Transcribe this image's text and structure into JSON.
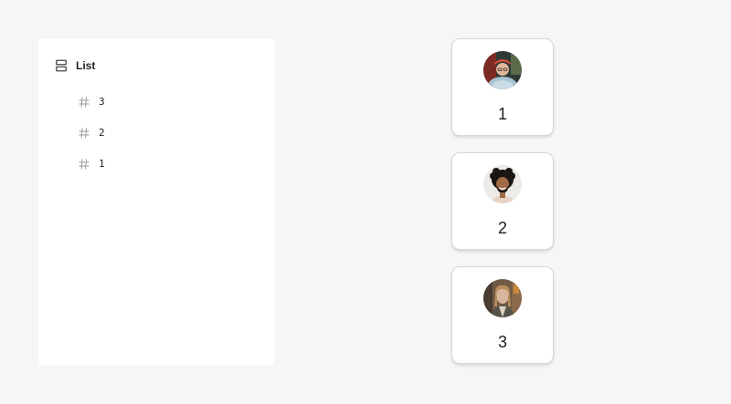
{
  "layers_panel": {
    "header": {
      "icon": "list-layout-icon",
      "title": "List"
    },
    "items": [
      {
        "icon": "hash-icon",
        "label": "3"
      },
      {
        "icon": "hash-icon",
        "label": "2"
      },
      {
        "icon": "hash-icon",
        "label": "1"
      }
    ]
  },
  "cards": [
    {
      "avatar": "avatar-photo",
      "label": "1"
    },
    {
      "avatar": "avatar-photo",
      "label": "2"
    },
    {
      "avatar": "avatar-photo",
      "label": "3"
    }
  ],
  "colors": {
    "background": "#f6f6f6",
    "panel": "#ffffff",
    "card_border": "#d7d7d7",
    "icon": "#444444",
    "hash": "#9a9a9a"
  }
}
